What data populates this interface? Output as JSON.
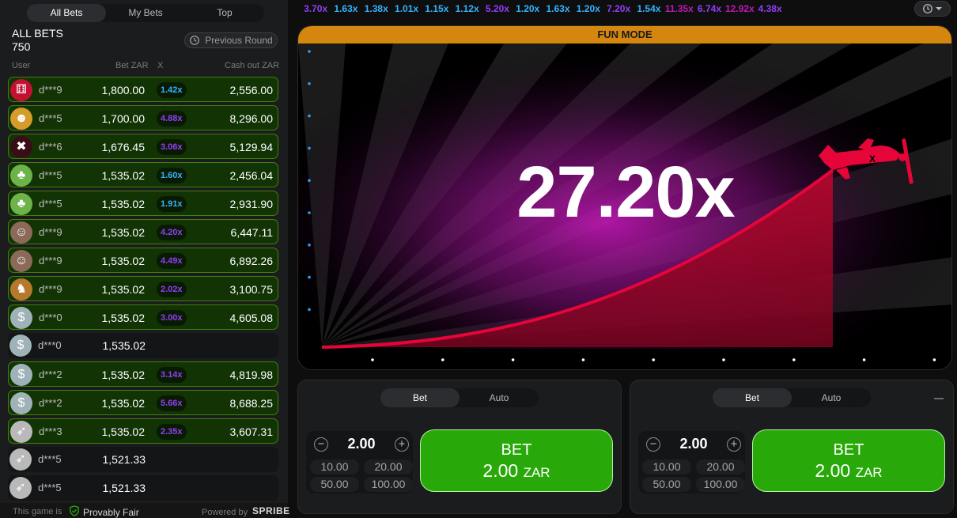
{
  "tabs": [
    "All Bets",
    "My Bets",
    "Top"
  ],
  "all_bets": {
    "title": "ALL BETS",
    "count": "750",
    "previous_round_label": "Previous Round"
  },
  "columns": {
    "user": "User",
    "bet": "Bet ZAR",
    "x": "X",
    "cashout": "Cash out ZAR"
  },
  "bets": [
    {
      "user": "d***9",
      "bet": "1,800.00",
      "mult": "1.42x",
      "mult_color": "#34b4ff",
      "cashout": "2,556.00",
      "win": true,
      "avatar": "dice-icon"
    },
    {
      "user": "d***5",
      "bet": "1,700.00",
      "mult": "4.88x",
      "mult_color": "#913ef8",
      "cashout": "8,296.00",
      "win": true,
      "avatar": "character-icon"
    },
    {
      "user": "d***6",
      "bet": "1,676.45",
      "mult": "3.06x",
      "mult_color": "#913ef8",
      "cashout": "5,129.94",
      "win": true,
      "avatar": "skull-icon"
    },
    {
      "user": "d***5",
      "bet": "1,535.02",
      "mult": "1.60x",
      "mult_color": "#34b4ff",
      "cashout": "2,456.04",
      "win": true,
      "avatar": "clover-icon"
    },
    {
      "user": "d***5",
      "bet": "1,535.02",
      "mult": "1.91x",
      "mult_color": "#34b4ff",
      "cashout": "2,931.90",
      "win": true,
      "avatar": "clover-icon"
    },
    {
      "user": "d***9",
      "bet": "1,535.02",
      "mult": "4.20x",
      "mult_color": "#913ef8",
      "cashout": "6,447.11",
      "win": true,
      "avatar": "person-icon"
    },
    {
      "user": "d***9",
      "bet": "1,535.02",
      "mult": "4.49x",
      "mult_color": "#913ef8",
      "cashout": "6,892.26",
      "win": true,
      "avatar": "person-icon"
    },
    {
      "user": "d***9",
      "bet": "1,535.02",
      "mult": "2.02x",
      "mult_color": "#913ef8",
      "cashout": "3,100.75",
      "win": true,
      "avatar": "tiger-icon"
    },
    {
      "user": "d***0",
      "bet": "1,535.02",
      "mult": "3.00x",
      "mult_color": "#913ef8",
      "cashout": "4,605.08",
      "win": true,
      "avatar": "money-icon"
    },
    {
      "user": "d***0",
      "bet": "1,535.02",
      "mult": "",
      "mult_color": "",
      "cashout": "",
      "win": false,
      "avatar": "money-icon"
    },
    {
      "user": "d***2",
      "bet": "1,535.02",
      "mult": "3.14x",
      "mult_color": "#913ef8",
      "cashout": "4,819.98",
      "win": true,
      "avatar": "money-icon"
    },
    {
      "user": "d***2",
      "bet": "1,535.02",
      "mult": "5.66x",
      "mult_color": "#913ef8",
      "cashout": "8,688.25",
      "win": true,
      "avatar": "money-icon"
    },
    {
      "user": "d***3",
      "bet": "1,535.02",
      "mult": "2.35x",
      "mult_color": "#913ef8",
      "cashout": "3,607.31",
      "win": true,
      "avatar": "eagle-icon"
    },
    {
      "user": "d***5",
      "bet": "1,521.33",
      "mult": "",
      "mult_color": "",
      "cashout": "",
      "win": false,
      "avatar": "eagle-icon"
    },
    {
      "user": "d***5",
      "bet": "1,521.33",
      "mult": "",
      "mult_color": "",
      "cashout": "",
      "win": false,
      "avatar": "eagle-icon"
    }
  ],
  "footer": {
    "text1": "This game is",
    "provably_fair": "Provably Fair",
    "powered_by": "Powered by",
    "brand": "SPRIBE"
  },
  "history": [
    {
      "v": "3.70x",
      "c": "#913ef8"
    },
    {
      "v": "1.63x",
      "c": "#34b4ff"
    },
    {
      "v": "1.38x",
      "c": "#34b4ff"
    },
    {
      "v": "1.01x",
      "c": "#34b4ff"
    },
    {
      "v": "1.15x",
      "c": "#34b4ff"
    },
    {
      "v": "1.12x",
      "c": "#34b4ff"
    },
    {
      "v": "5.20x",
      "c": "#913ef8"
    },
    {
      "v": "1.20x",
      "c": "#34b4ff"
    },
    {
      "v": "1.63x",
      "c": "#34b4ff"
    },
    {
      "v": "1.20x",
      "c": "#34b4ff"
    },
    {
      "v": "7.20x",
      "c": "#913ef8"
    },
    {
      "v": "1.54x",
      "c": "#34b4ff"
    },
    {
      "v": "11.35x",
      "c": "#c017b4"
    },
    {
      "v": "6.74x",
      "c": "#913ef8"
    },
    {
      "v": "12.92x",
      "c": "#c017b4"
    },
    {
      "v": "4.38x",
      "c": "#913ef8"
    }
  ],
  "game": {
    "mode_label": "FUN MODE",
    "multiplier": "27.20x"
  },
  "bet_panels": [
    {
      "tab_bet": "Bet",
      "tab_auto": "Auto",
      "amount": "2.00",
      "quick": [
        "10.00",
        "20.00",
        "50.00",
        "100.00"
      ],
      "btn_label": "BET",
      "btn_amount": "2.00",
      "currency": "ZAR"
    },
    {
      "tab_bet": "Bet",
      "tab_auto": "Auto",
      "amount": "2.00",
      "quick": [
        "10.00",
        "20.00",
        "50.00",
        "100.00"
      ],
      "btn_label": "BET",
      "btn_amount": "2.00",
      "currency": "ZAR"
    }
  ],
  "colors": {
    "accent_green": "#28a909",
    "fun_mode": "#d4860f",
    "plane_red": "#e50539"
  }
}
